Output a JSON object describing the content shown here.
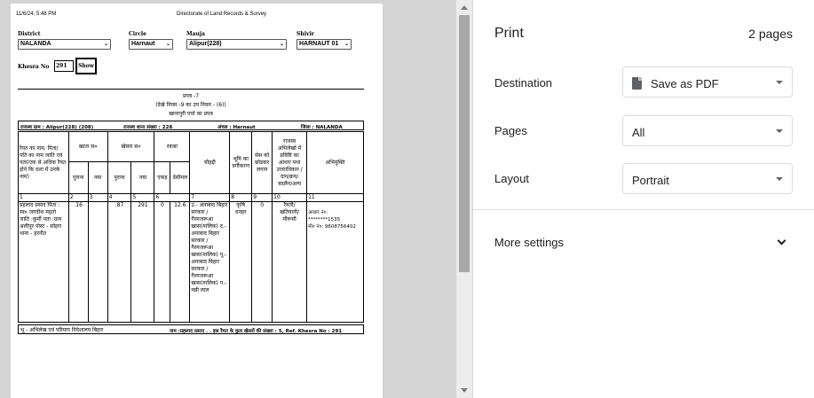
{
  "preview": {
    "timestamp": "11/6/24, 5:48 PM",
    "site_title": "Directorate of Land Records & Survey",
    "filters": [
      {
        "label": "District",
        "value": "NALANDA"
      },
      {
        "label": "Circle",
        "value": "Harnaut"
      },
      {
        "label": "Mauja",
        "value": "Alipur(228)"
      },
      {
        "label": "Shivir",
        "value": "HARNAUT 01"
      }
    ],
    "khesra_label": "Khesra No",
    "khesra_value": "291",
    "show_button": "Show",
    "doc": {
      "form_title": "प्रपत्र -7",
      "rule_ref": "(देखे नियम -9 का उप नियम - (6))",
      "heading": "खानापुरी पर्चा का प्रपत्र",
      "revenue_village": "राजस्व ग्राम : Alipur(228) (208)",
      "thana_no": "राजस्व थाना संख्या : 228",
      "anchal": "अंचल : Harnaut",
      "jila": "जिला : NALANDA",
      "col_raiyat": "रैयत का नाम, पिता/ पति का नाम जाति एवं पता(एक से अधिक रैयत होने कि दशा में उनके नाम)",
      "col_khata": "खाता स०",
      "col_khesra": "खेसरा स०",
      "col_rakba": "रकबा",
      "col_chauhaddi": "चौहद्दी",
      "col_bhumi": "भूमि का वर्गीकरण",
      "col_ses": "सेस को छोडकर लगान",
      "col_rajasv": "राजस्व अभिलेखों में प्रविष्टि का आधार यथा उत्तराधिकार /दान/क्रय/ बदलैन/अन्य",
      "col_abhyukti": "अभियुक्ति",
      "sub_purana": "पुराना",
      "sub_naya": "नया",
      "sub_acre": "एकड़",
      "sub_decimal": "डेसीमल",
      "colnums": [
        "1",
        "2",
        "3",
        "4",
        "5",
        "6",
        "7",
        "8",
        "9",
        "10",
        "11"
      ],
      "row": {
        "raiyat": "प्रहलाद प्रसाद पिता : स्व० जगदीश महतो जाति :कुर्मी पता :ग्राम अलीपुर पोस्ट - सोहरा थाना - हरनौत",
        "khata_old": ".16",
        "khata_new": "",
        "khesra_old": ".87",
        "khesra_new": "291",
        "acre": "0",
        "decimal": "12.6",
        "chauhaddi": "उ.- अनाबाद बिहार सरकार /गैरमजरूआ खास(मालिक) द.- अनाबाद बिहार सरकार /गैरमजरूआ खास(मालिक) पू.- अनाबाद बिहार सरकार /गैरमजरूआ खास(मालिक) प.- मन्नी लाल",
        "bhumi": "कृषि धनहर",
        "lagan": "0",
        "rajasv": "रैयती/ खतियानी/ मौरूसी",
        "abhyukti_1": "आधार नं०:",
        "abhyukti_2": "********1535",
        "abhyukti_3": "मो० नं०: 9608756402"
      },
      "footer_left": "भू - अभिलेख एवं परिमाप निदेशालय बिहार",
      "footer_right": "नाम :प्रहलाद प्रसाद . . इस रैयत के कुल खेसरों की संख्या : 5, Ref. Khesra No : 291"
    }
  },
  "panel": {
    "title": "Print",
    "pages_count": "2 pages",
    "destination_label": "Destination",
    "destination_value": "Save as PDF",
    "pages_label": "Pages",
    "pages_value": "All",
    "layout_label": "Layout",
    "layout_value": "Portrait",
    "more_settings": "More settings"
  }
}
